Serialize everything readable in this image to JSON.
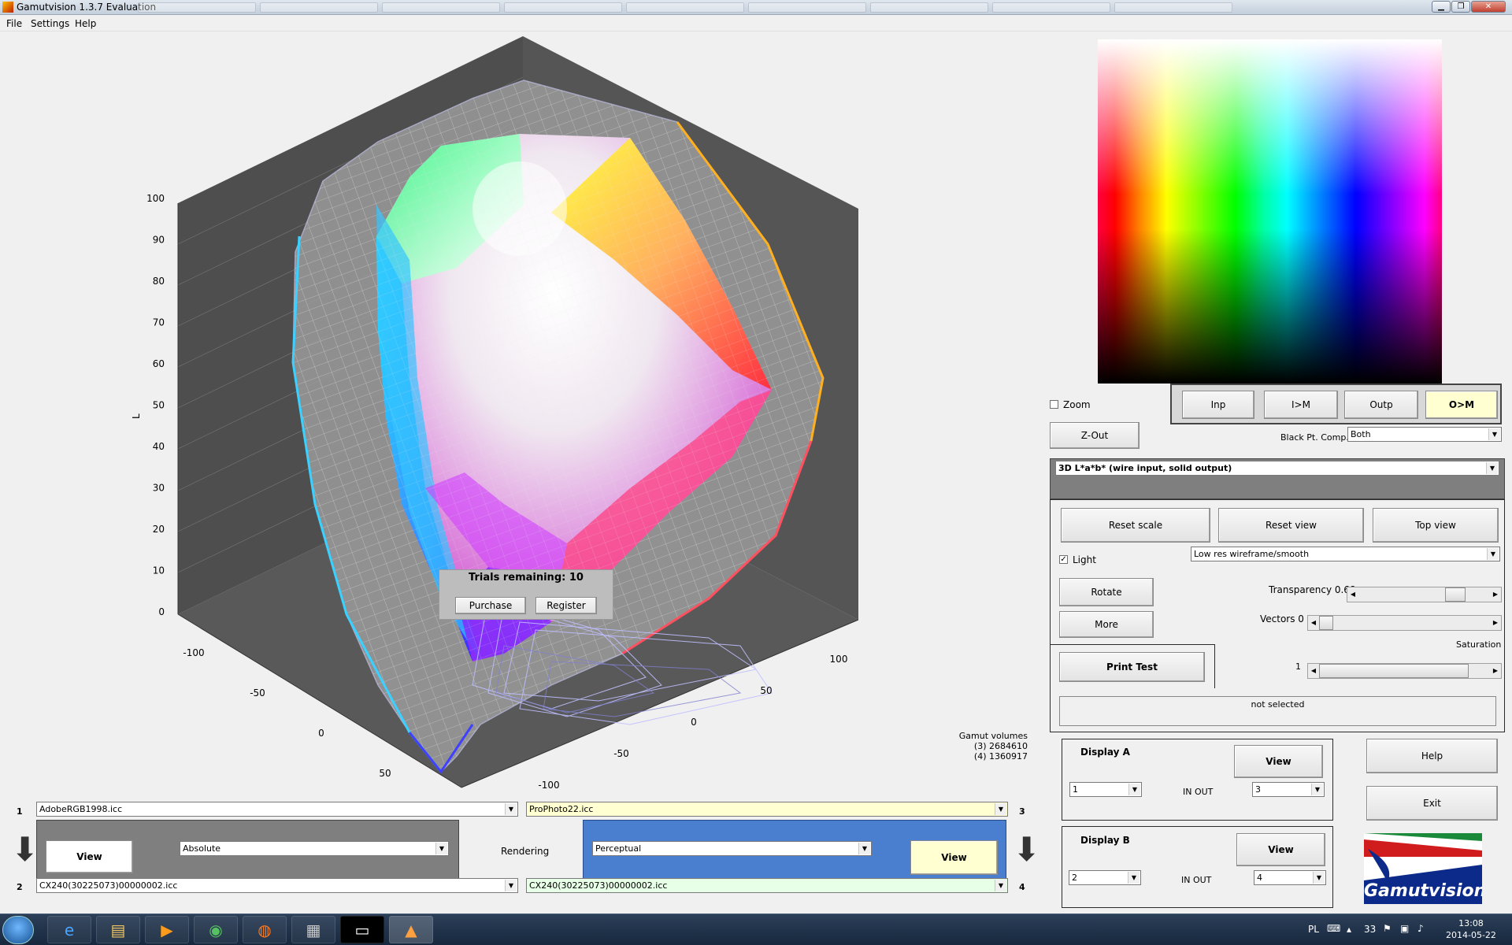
{
  "window": {
    "title": "Gamutvision 1.3.7  Evaluation",
    "min": "▁",
    "max": "❐",
    "close": "✕"
  },
  "menu": [
    "File",
    "Settings",
    "Help"
  ],
  "plot": {
    "l_axis_label": "L",
    "l_ticks": [
      "100",
      "90",
      "80",
      "70",
      "60",
      "50",
      "40",
      "30",
      "20",
      "10",
      "0"
    ],
    "a_ticks": [
      "-100",
      "-50",
      "0",
      "50",
      "100"
    ],
    "b_ticks": [
      "100",
      "50",
      "0",
      "-50",
      "-100"
    ],
    "trial": {
      "title": "Trials remaining: 10",
      "purchase": "Purchase",
      "register": "Register"
    },
    "gamut": {
      "title": "Gamut volumes",
      "v3": "(3)  2684610",
      "v4": "(4)  1360917"
    }
  },
  "mode_buttons": [
    "Inp",
    "I>M",
    "Outp",
    "O>M"
  ],
  "zoom": {
    "label": "Zoom",
    "checked": false
  },
  "zout": "Z-Out",
  "bpc": {
    "label": "Black Pt. Comp.",
    "value": "Both"
  },
  "view_select": "3D L*a*b* (wire input, solid output)",
  "buttons": {
    "reset_scale": "Reset scale",
    "reset_view": "Reset view",
    "top_view": "Top view",
    "rotate": "Rotate",
    "more": "More",
    "print_test": "Print Test",
    "help": "Help",
    "exit": "Exit"
  },
  "light": {
    "label": "Light",
    "checked": true
  },
  "render_mode": "Low res wireframe/smooth",
  "transparency": {
    "label": "Transparency 0.68",
    "value": 0.68
  },
  "vectors": {
    "label": "Vectors 0",
    "value": 0
  },
  "saturation": {
    "label": "Saturation",
    "value_label": "1",
    "value": 1
  },
  "status": "not selected",
  "display_a": {
    "title": "Display A",
    "view": "View",
    "in": "1",
    "inout": "IN  OUT",
    "out": "3"
  },
  "display_b": {
    "title": "Display B",
    "view": "View",
    "in": "2",
    "inout": "IN  OUT",
    "out": "4"
  },
  "logo": "Gamutvision",
  "files": {
    "n1": "1",
    "f1": "AdobeRGB1998.icc",
    "n2": "2",
    "f2": "CX240(30225073)00000002.icc",
    "n3": "3",
    "f3": "ProPhoto22.icc",
    "n4": "4",
    "f4": "CX240(30225073)00000002.icc",
    "left_view": "View",
    "left_intent": "Absolute",
    "rendering": "Rendering",
    "right_intent": "Perceptual",
    "right_view": "View",
    "arrow": "⬇"
  },
  "taskbar": {
    "lang": "PL",
    "num": "33",
    "time": "13:08",
    "date": "2014-05-22"
  },
  "colors": {
    "gray_panel": "#7f7f7f",
    "blue_panel": "#4a7fcf",
    "yellow": "#ffffd2"
  }
}
